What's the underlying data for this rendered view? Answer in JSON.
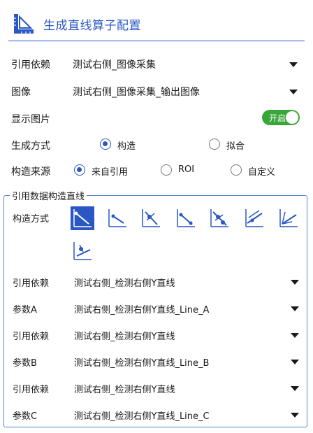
{
  "header": {
    "title": "生成直线算子配置",
    "icon": "ruler-triangle-icon"
  },
  "ref_depend": {
    "label": "引用依赖",
    "value": "测试右侧_图像采集"
  },
  "image": {
    "label": "图像",
    "value": "测试右侧_图像采集_输出图像"
  },
  "show_image": {
    "label": "显示图片",
    "toggle_text": "开启",
    "on": true
  },
  "gen_mode": {
    "label": "生成方式",
    "options": [
      {
        "label": "构造",
        "checked": true
      },
      {
        "label": "拟合",
        "checked": false
      }
    ]
  },
  "source": {
    "label": "构造来源",
    "options": [
      {
        "label": "来自引用",
        "checked": true
      },
      {
        "label": "ROI",
        "checked": false
      },
      {
        "label": "自定义",
        "checked": false
      }
    ]
  },
  "group": {
    "title": "引用数据构造直线",
    "mode_label": "构造方式",
    "modes": [
      "point-direction-icon",
      "two-point-line-icon",
      "angle-line-icon",
      "point-slope-icon",
      "perpendicular-line-icon",
      "parallel-line-icon",
      "bisector-line-icon",
      "offset-line-icon"
    ],
    "fields": [
      {
        "label": "引用依赖",
        "value": "测试右侧_检测右侧Y直线"
      },
      {
        "label": "参数A",
        "value": "测试右侧_检测右侧Y直线_Line_A"
      },
      {
        "label": "引用依赖",
        "value": "测试右侧_检测右侧Y直线"
      },
      {
        "label": "参数B",
        "value": "测试右侧_检测右侧Y直线_Line_B"
      },
      {
        "label": "引用依赖",
        "value": "测试右侧_检测右侧Y直线"
      },
      {
        "label": "参数C",
        "value": "测试右侧_检测右侧Y直线_Line_C"
      }
    ]
  },
  "colors": {
    "accent": "#2b57c5",
    "toggle_on": "#3aa63a"
  }
}
